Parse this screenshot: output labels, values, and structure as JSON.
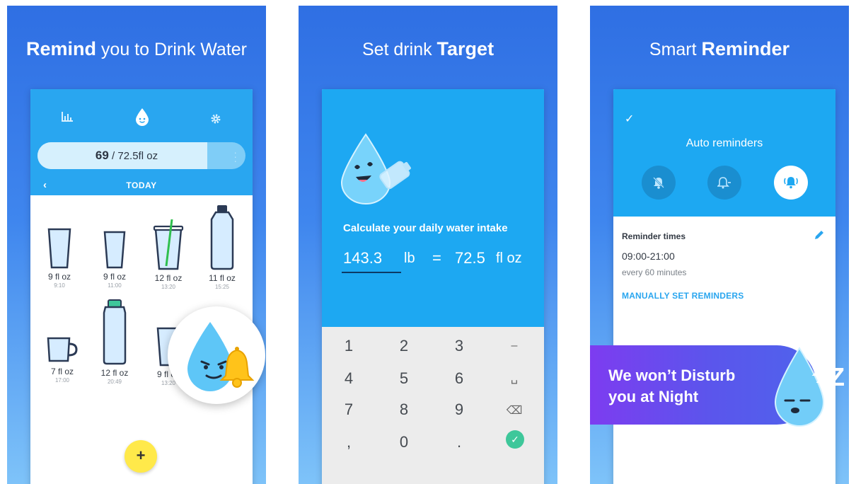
{
  "panel1": {
    "headline_bold": "Remind",
    "headline_rest": " you to Drink Water",
    "icons": [
      "stats-icon",
      "drop-face-icon",
      "gear-icon"
    ],
    "progress": {
      "current": "69",
      "separator": " / ",
      "target": "72.5fl oz",
      "fraction": 0.951
    },
    "nav": {
      "back": "‹",
      "date": "TODAY"
    },
    "drinks": [
      {
        "amount": "9 fl oz",
        "time": "9:10",
        "type": "glass"
      },
      {
        "amount": "9 fl oz",
        "time": "11:00",
        "type": "glass"
      },
      {
        "amount": "12 fl oz",
        "time": "13:20",
        "type": "cup-straw"
      },
      {
        "amount": "11 fl oz",
        "time": "15:25",
        "type": "bottle"
      },
      {
        "amount": "7 fl oz",
        "time": "17:00",
        "type": "mug"
      },
      {
        "amount": "12 fl oz",
        "time": "20:49",
        "type": "bottle-green"
      },
      {
        "amount": "9 fl oz",
        "time": "13:20",
        "type": "glass"
      }
    ],
    "add_label": "+"
  },
  "panel2": {
    "headline_rest": "Set drink ",
    "headline_bold": "Target",
    "calc_title": "Calculate your daily water intake",
    "weight_value": "143.3",
    "weight_unit": "lb",
    "equals": "=",
    "target_value": "72.5",
    "target_unit": "fl oz",
    "keypad": [
      [
        "1",
        "2",
        "3",
        "–"
      ],
      [
        "4",
        "5",
        "6",
        "␣"
      ],
      [
        "7",
        "8",
        "9",
        "⌫"
      ],
      [
        ",",
        "0",
        ".",
        "✓"
      ]
    ]
  },
  "panel3": {
    "headline_rest": "Smart ",
    "headline_bold": "Reminder",
    "check": "✓",
    "auto_label": "Auto reminders",
    "modes": [
      "bell-off-icon",
      "bell-minus-icon",
      "bell-ringing-icon"
    ],
    "reminder_times_label": "Reminder times",
    "time_range": "09:00-21:00",
    "interval": "every 60 minutes",
    "manual_link": "MANUALLY SET REMINDERS",
    "banner_line1": "We won’t Disturb",
    "banner_line2": "you at Night",
    "zzz": "Z"
  },
  "colors": {
    "accent_blue": "#1da8f2",
    "header_blue": "#29a6f0",
    "banner_purple": "#7d3cf0",
    "fab_yellow": "#ffe94a",
    "check_green": "#3ec79a"
  }
}
